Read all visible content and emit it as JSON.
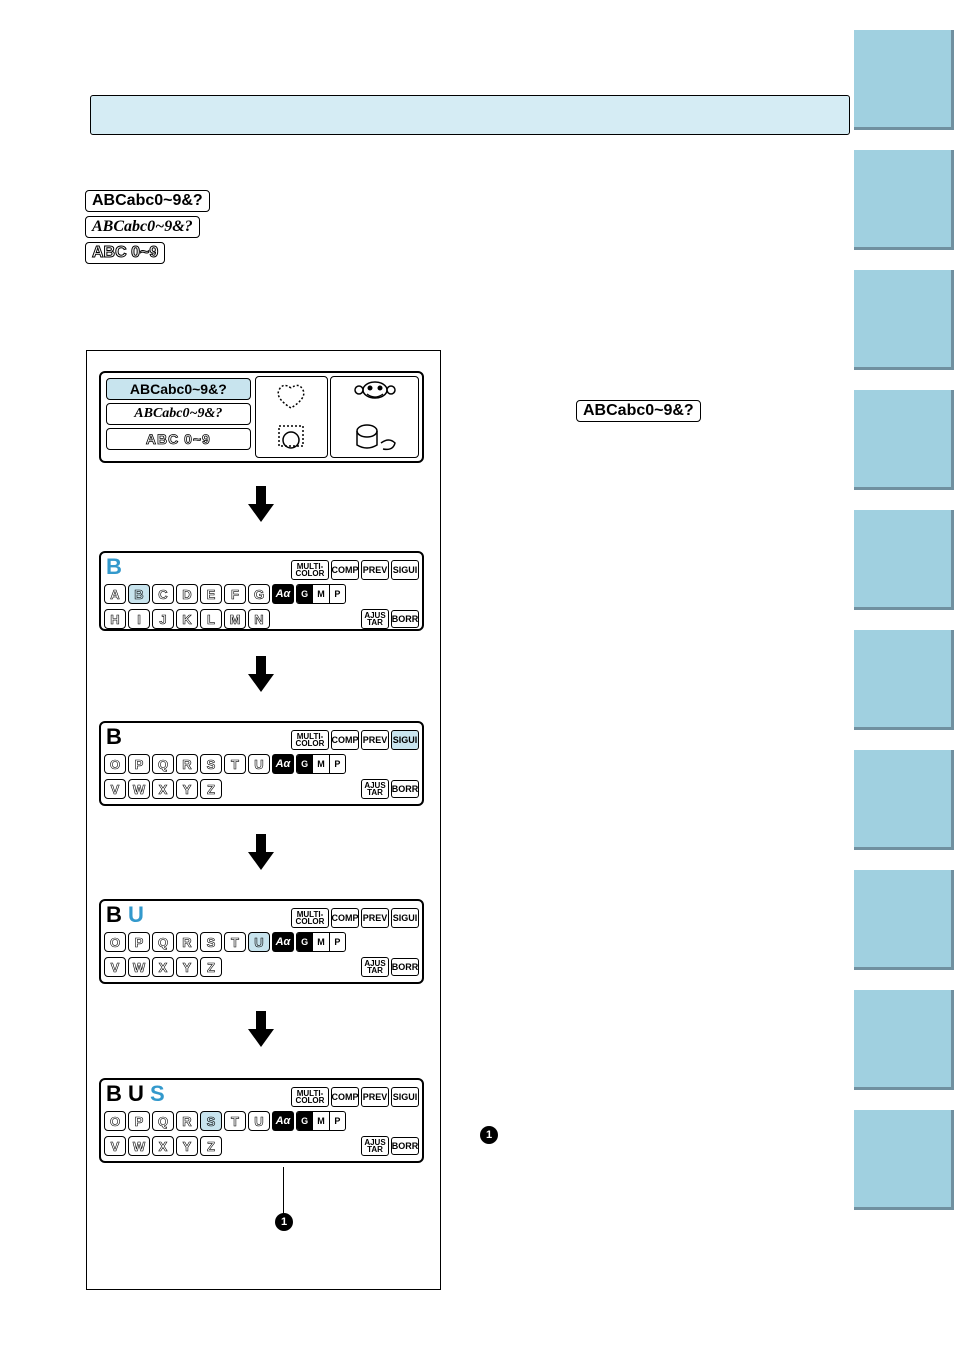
{
  "fonts": {
    "sans": "ABCabc0~9&?",
    "serif": "ABCabc0~9&?",
    "outline": "ABC 0~9"
  },
  "topScreen": {
    "f1": "ABCabc0~9&?",
    "f2": "ABCabc0~9&?",
    "f3": "ABC 0~9"
  },
  "rightRef": "ABCabc0~9&?",
  "btns": {
    "multi1": "MULTI-",
    "multi2": "COLOR",
    "comp": "COMP",
    "prev": "PREV",
    "sigui": "SIGUI",
    "ajus1": "AJUS",
    "ajus2": "TAR",
    "borr": "BORR",
    "mode": "Aα",
    "g": "G",
    "m": "M",
    "p": "P"
  },
  "screens": {
    "s1": {
      "preview_blue": "B",
      "preview_black": "",
      "row2": [
        "A",
        "B",
        "C",
        "D",
        "E",
        "F",
        "G"
      ],
      "row2_hl": "B",
      "row3": [
        "H",
        "I",
        "J",
        "K",
        "L",
        "M",
        "N"
      ],
      "show_ajus_row2": false,
      "sigui_hl": false
    },
    "s2": {
      "preview_blue": "",
      "preview_black": "B",
      "row2": [
        "O",
        "P",
        "Q",
        "R",
        "S",
        "T",
        "U"
      ],
      "row2_hl": "",
      "row3": [
        "V",
        "W",
        "X",
        "Y",
        "Z"
      ],
      "show_ajus_row2": false,
      "sigui_hl": true
    },
    "s3": {
      "preview_blue": "U",
      "preview_black": "B ",
      "row2": [
        "O",
        "P",
        "Q",
        "R",
        "S",
        "T",
        "U"
      ],
      "row2_hl": "U",
      "row3": [
        "V",
        "W",
        "X",
        "Y",
        "Z"
      ],
      "show_ajus_row2": false,
      "sigui_hl": false
    },
    "s4": {
      "preview_blue": "S",
      "preview_black": "B U ",
      "row2": [
        "O",
        "P",
        "Q",
        "R",
        "S",
        "T",
        "U"
      ],
      "row2_hl": "S",
      "row3": [
        "V",
        "W",
        "X",
        "Y",
        "Z"
      ],
      "show_ajus_row2": false,
      "sigui_hl": false
    }
  },
  "callout": "1"
}
